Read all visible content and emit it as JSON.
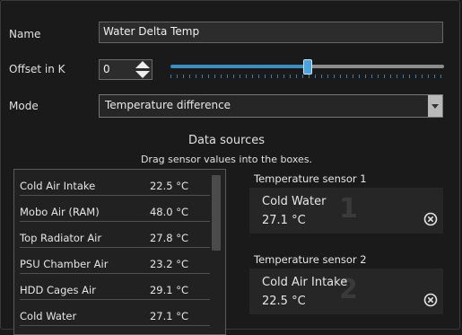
{
  "form": {
    "name_label": "Name",
    "name_value": "Water Delta Temp",
    "offset_label": "Offset in K",
    "offset_value": "0",
    "offset_slider_level": 0.5,
    "mode_label": "Mode",
    "mode_value": "Temperature difference"
  },
  "data_sources": {
    "title": "Data sources",
    "subtitle": "Drag sensor values into the boxes.",
    "rows": [
      {
        "name": "Cold Air Intake",
        "value": "22.5 °C"
      },
      {
        "name": "Mobo Air (RAM)",
        "value": "48.0 °C"
      },
      {
        "name": "Top Radiator Air",
        "value": "27.8 °C"
      },
      {
        "name": "PSU Chamber Air",
        "value": "23.2 °C"
      },
      {
        "name": "HDD Cages Air",
        "value": "29.1 °C"
      },
      {
        "name": "Cold Water",
        "value": "27.1 °C"
      }
    ]
  },
  "sensors": [
    {
      "label": "Temperature sensor 1",
      "name": "Cold Water",
      "value": "27.1 °C",
      "number": "1"
    },
    {
      "label": "Temperature sensor 2",
      "name": "Cold Air Intake",
      "value": "22.5 °C",
      "number": "2"
    }
  ],
  "colors": {
    "accent": "#3a8ec4",
    "background": "#1a1a1a"
  }
}
